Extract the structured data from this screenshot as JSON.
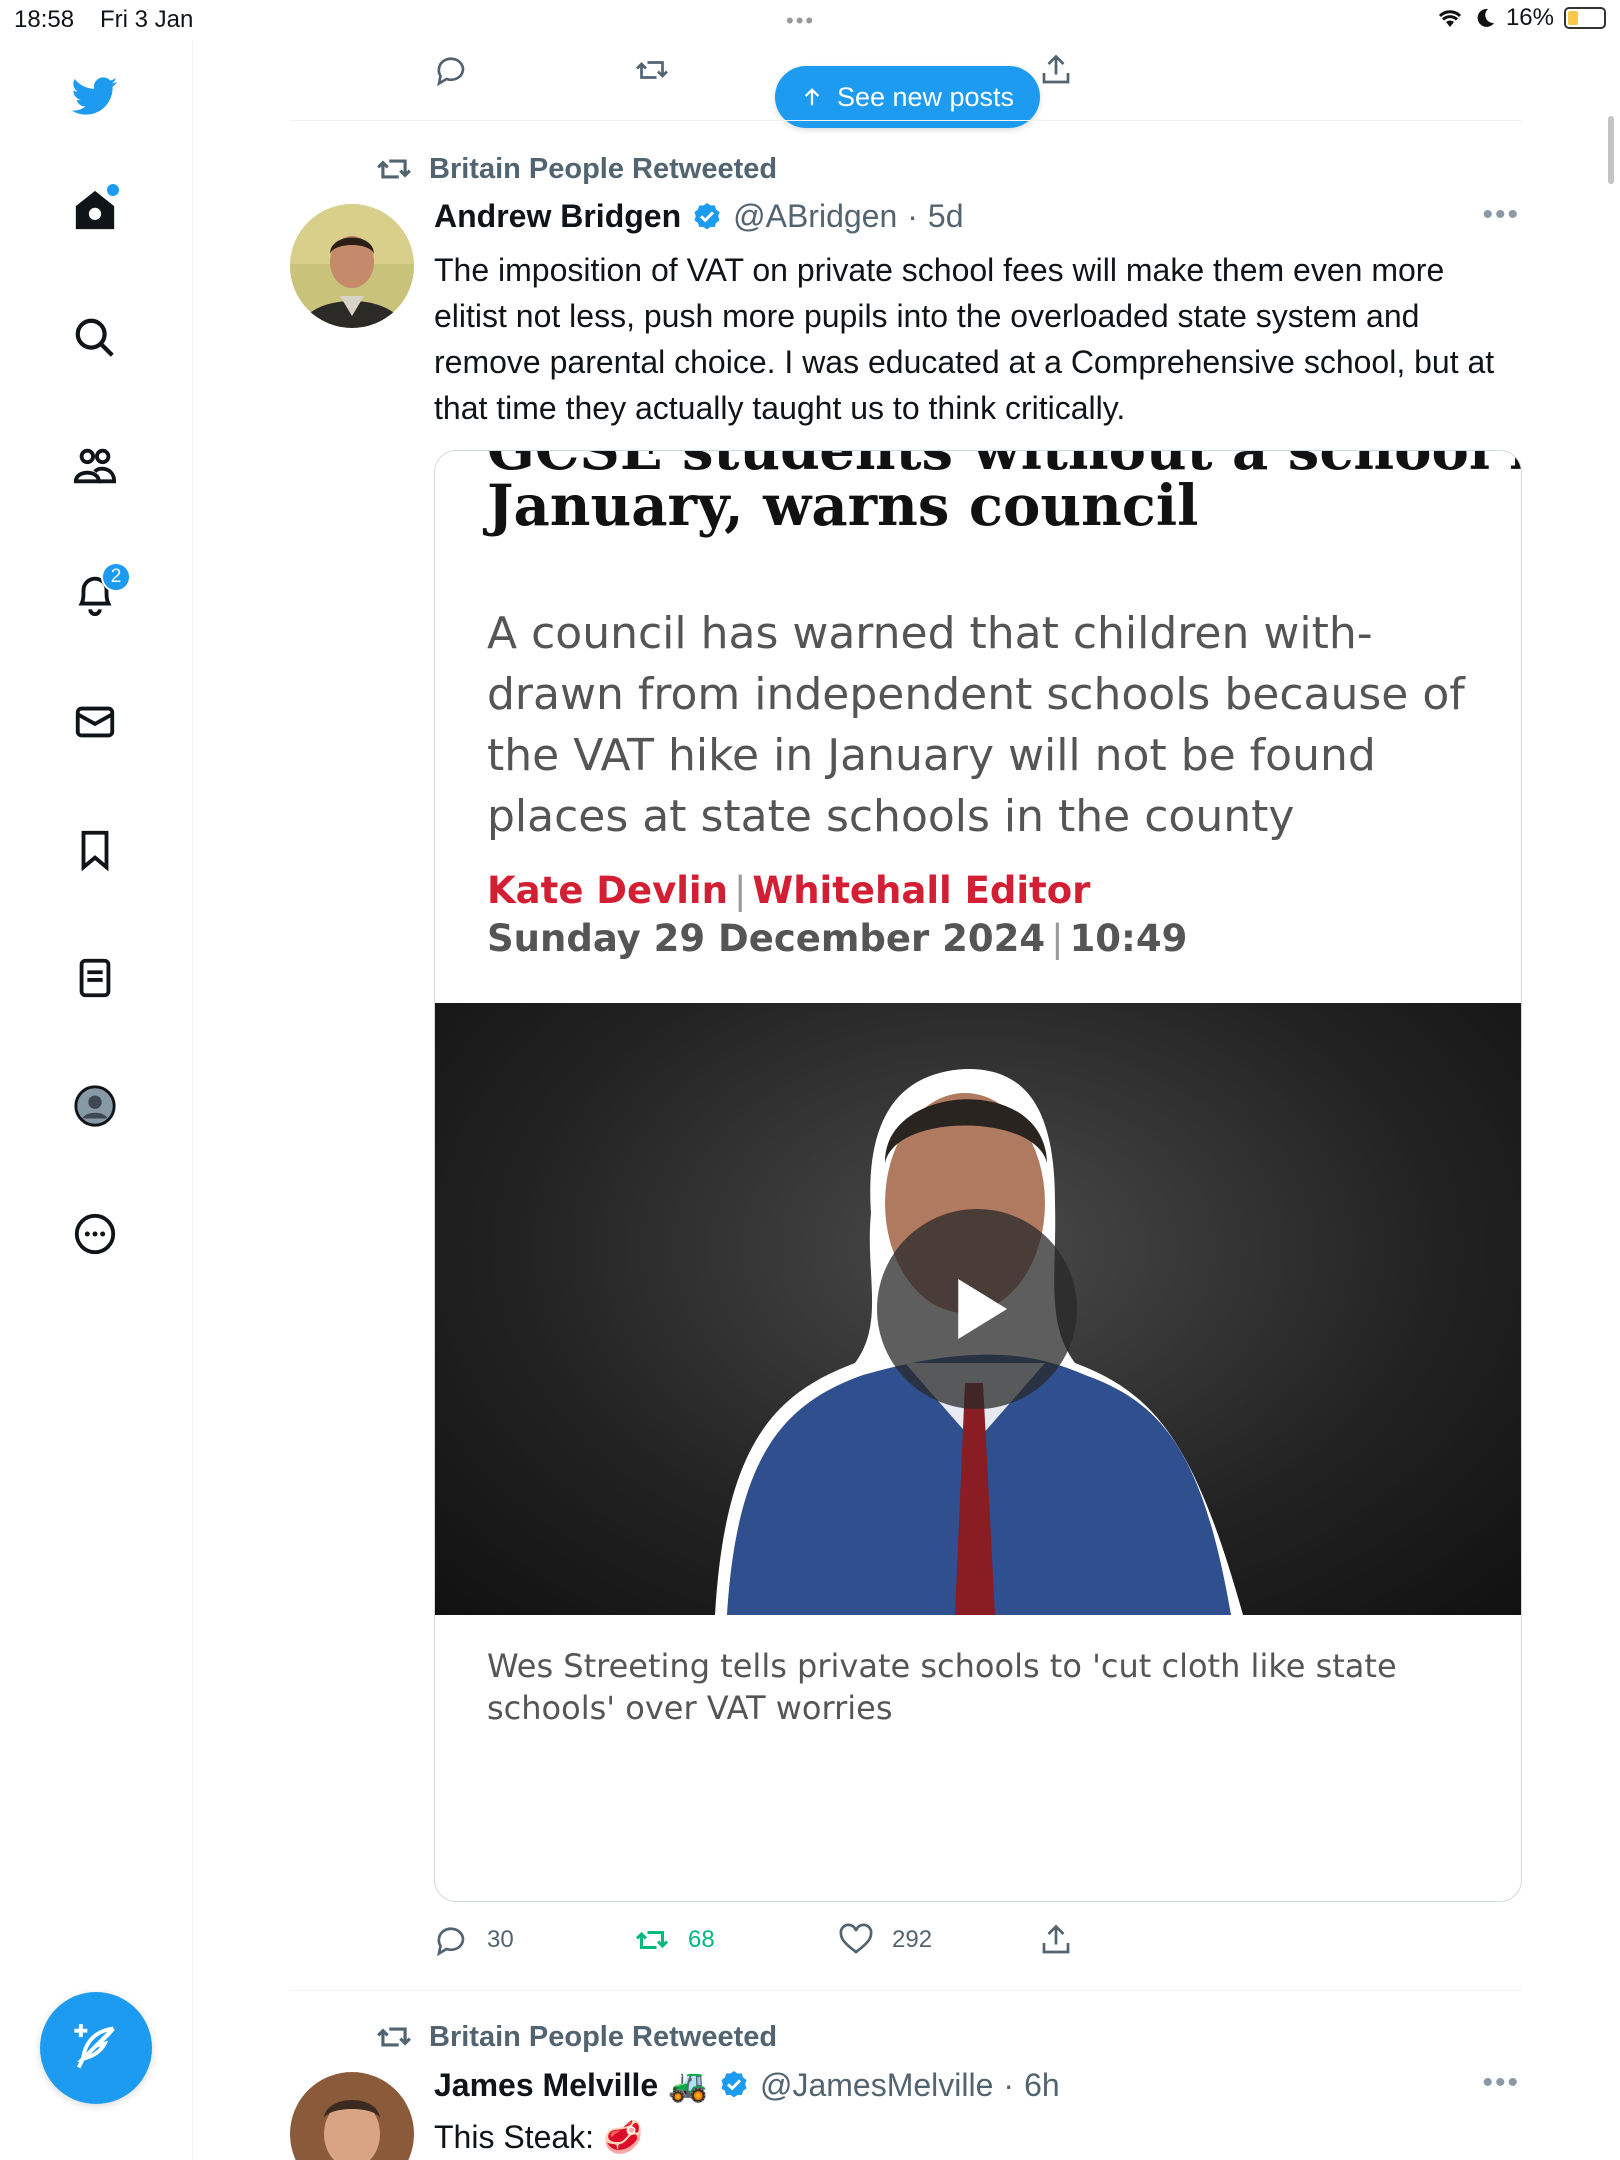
{
  "status_bar": {
    "time": "18:58",
    "date": "Fri 3 Jan",
    "battery": "16%"
  },
  "sidebar": {
    "notifications_badge": "2"
  },
  "top_action_bar": {
    "see_new_posts": "See new posts"
  },
  "tweets": [
    {
      "retweeted_by": "Britain People Retweeted",
      "name": "Andrew Bridgen",
      "handle": "@ABridgen",
      "separator": "·",
      "time": "5d",
      "text": "The imposition of VAT on private school fees will make them even more elitist not less, push more pupils into the overloaded state system and remove parental choice. I was educated at a Comprehensive school, but at that time they actually taught us to think critically.",
      "card": {
        "headline_cut": "GCSE students without a school by",
        "headline": "January, warns council",
        "standfirst": "A council has warned that children with-drawn from independent schools because of the VAT hike in January will not be found places at state schools in the county",
        "author": "Kate Devlin",
        "author_role": "Whitehall Editor",
        "date": "Sunday 29 December 2024",
        "time": "10:49",
        "caption": "Wes Streeting tells private schools to 'cut cloth like state schools' over VAT worries"
      },
      "replies": "30",
      "retweets": "68",
      "likes": "292"
    },
    {
      "retweeted_by": "Britain People Retweeted",
      "name": "James Melville",
      "name_emoji": "🚜",
      "handle": "@JamesMelville",
      "separator": "·",
      "time": "6h",
      "text": "This Steak: 🥩"
    }
  ],
  "colors": {
    "accent": "#1d9bf0",
    "retweet_green": "#00ba7c",
    "byline_red": "#d21f33"
  }
}
